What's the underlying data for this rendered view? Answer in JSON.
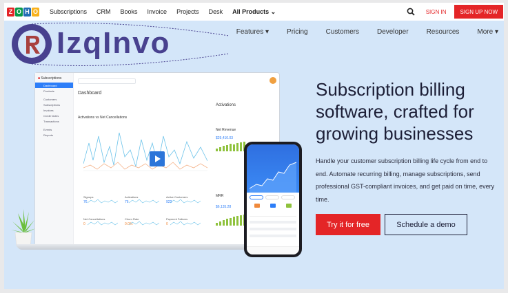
{
  "topbar": {
    "zoho_letters": [
      {
        "char": "Z",
        "color": "#e42527"
      },
      {
        "char": "O",
        "color": "#089949"
      },
      {
        "char": "H",
        "color": "#226db4"
      },
      {
        "char": "O",
        "color": "#f9b21d"
      }
    ],
    "links": [
      "Subscriptions",
      "CRM",
      "Books",
      "Invoice",
      "Projects",
      "Desk"
    ],
    "all_products": "All Products",
    "sign_in": "SIGN IN",
    "sign_up": "SIGN UP NOW"
  },
  "brand": {
    "name": "IzqInvo"
  },
  "nav": [
    "Features",
    "Pricing",
    "Customers",
    "Developer",
    "Resources",
    "More"
  ],
  "mockup": {
    "app_name": "Subscriptions",
    "dashboard_title": "Dashboard",
    "chart_title": "Activations vs Net Cancellations",
    "activations": "Activations",
    "net_revenue": "Net Revenue",
    "revenue_value": "$29,410.03",
    "mrr_label": "MRR",
    "mrr_value": "$6,135.28",
    "stats": [
      {
        "label": "Signups",
        "value": "76"
      },
      {
        "label": "Activations",
        "value": "76"
      },
      {
        "label": "Active Customers",
        "value": "922"
      },
      {
        "label": "Net Cancellations",
        "value": "0"
      },
      {
        "label": "Churn Rate",
        "value": "0.0%"
      },
      {
        "label": "Payment Failures",
        "value": "0"
      }
    ],
    "sidebar": [
      "Dashboard",
      "Products",
      "Customers",
      "Subscriptions",
      "Invoices",
      "Credit Notes",
      "Transactions",
      "Events",
      "Reports"
    ]
  },
  "hero": {
    "title": "Subscription billing software, crafted for growing businesses",
    "subtitle": "Handle your customer subscription billing life cycle from end to end. Automate recurring billing, manage subscriptions, send professional GST-compliant invoices, and get paid on time, every time.",
    "try_button": "Try it for free",
    "demo_button": "Schedule a demo"
  }
}
